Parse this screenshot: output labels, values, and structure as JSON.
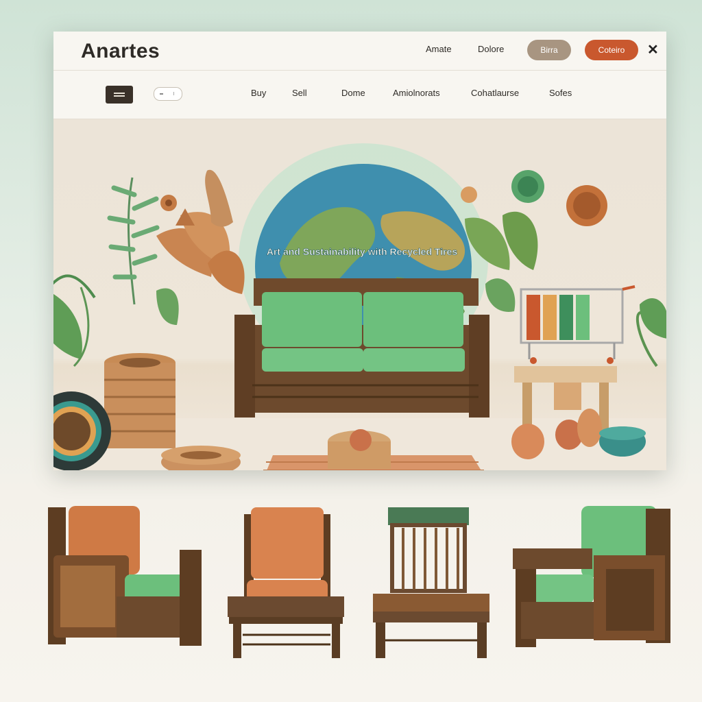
{
  "header": {
    "brand": "Anartes",
    "links": [
      "Amate",
      "Dolore"
    ],
    "button_muted": "Birra",
    "button_accent": "Coteiro",
    "close_glyph": "✕"
  },
  "nav": {
    "items": [
      "Buy",
      "Sell",
      "Dome",
      "Amiolnorats",
      "Cohatlaurse",
      "Sofes"
    ]
  },
  "hero": {
    "title": "Art and Sustainability with Recycled Tires"
  },
  "colors": {
    "accent": "#c9582e",
    "muted": "#a89581",
    "cushion_green": "#6cbf7c",
    "cushion_orange": "#d9834f",
    "wood": "#6b4a30"
  },
  "icons": [
    "menu-icon",
    "search-icon",
    "close-icon",
    "shopping-cart-icon",
    "globe-icon"
  ]
}
